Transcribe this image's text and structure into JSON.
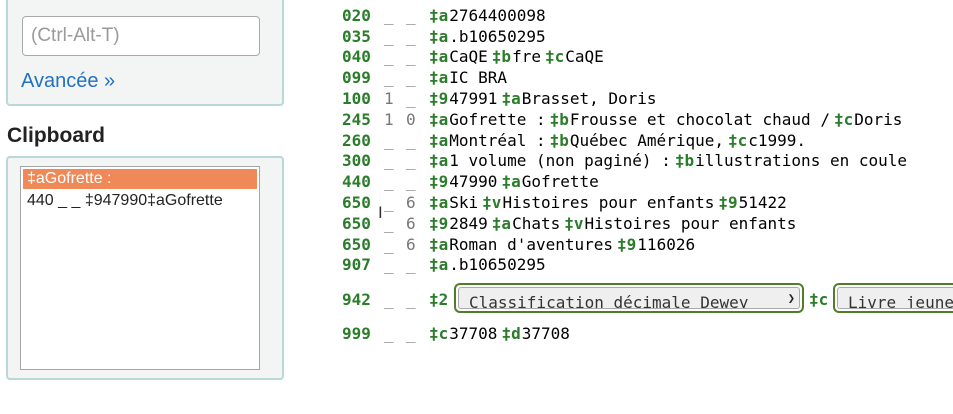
{
  "sidebar": {
    "search": {
      "placeholder": "(Ctrl-Alt-T)",
      "advanced_label": "Avancée »"
    },
    "clipboard": {
      "title": "Clipboard",
      "items": [
        {
          "text": "‡aGofrette :",
          "selected": true
        },
        {
          "text": "440 _ _ ‡947990‡aGofrette",
          "selected": false
        }
      ]
    }
  },
  "marc": {
    "rows": [
      {
        "tag": "020",
        "ind1": "_",
        "ind2": "_",
        "subfields": [
          {
            "code": "‡a",
            "value": "2764400098"
          }
        ]
      },
      {
        "tag": "035",
        "ind1": "_",
        "ind2": "_",
        "subfields": [
          {
            "code": "‡a",
            "value": ".b10650295"
          }
        ]
      },
      {
        "tag": "040",
        "ind1": "_",
        "ind2": "_",
        "subfields": [
          {
            "code": "‡a",
            "value": "CaQE"
          },
          {
            "code": "‡b",
            "value": "fre"
          },
          {
            "code": "‡c",
            "value": "CaQE"
          }
        ]
      },
      {
        "tag": "099",
        "ind1": "_",
        "ind2": "_",
        "subfields": [
          {
            "code": "‡a",
            "value": "IC BRA"
          }
        ]
      },
      {
        "tag": "100",
        "ind1": "1",
        "ind2": "_",
        "subfields": [
          {
            "code": "‡9",
            "value": "47991"
          },
          {
            "code": "‡a",
            "value": "Brasset, Doris"
          }
        ]
      },
      {
        "tag": "245",
        "ind1": "1",
        "ind2": "0",
        "subfields": [
          {
            "code": "‡a",
            "value": "Gofrette :"
          },
          {
            "code": "‡b",
            "value": "Frousse et chocolat chaud /"
          },
          {
            "code": "‡c",
            "value": "Doris"
          }
        ]
      },
      {
        "tag": "260",
        "ind1": "_",
        "ind2": "_",
        "subfields": [
          {
            "code": "‡a",
            "value": "Montréal :"
          },
          {
            "code": "‡b",
            "value": "Québec Amérique,"
          },
          {
            "code": "‡c",
            "value": "c1999."
          }
        ]
      },
      {
        "tag": "300",
        "ind1": "_",
        "ind2": "_",
        "subfields": [
          {
            "code": "‡a",
            "value": "1 volume (non paginé) :"
          },
          {
            "code": "‡b",
            "value": "illustrations en coule"
          }
        ]
      },
      {
        "tag": "440",
        "ind1": "_",
        "ind2": "_",
        "subfields": [
          {
            "code": "‡9",
            "value": "47990"
          },
          {
            "code": "‡a",
            "value": "Gofrette"
          }
        ]
      },
      {
        "tag": "650",
        "ind1": "_",
        "ind2": "6",
        "subfields": [
          {
            "code": "‡a",
            "value": "Ski"
          },
          {
            "code": "‡v",
            "value": "Histoires pour enfants"
          },
          {
            "code": "‡9",
            "value": "51422"
          }
        ]
      },
      {
        "tag": "650",
        "ind1": "_",
        "ind2": "6",
        "subfields": [
          {
            "code": "‡9",
            "value": "2849"
          },
          {
            "code": "‡a",
            "value": "Chats"
          },
          {
            "code": "‡v",
            "value": "Histoires pour enfants"
          }
        ]
      },
      {
        "tag": "650",
        "ind1": "_",
        "ind2": "6",
        "subfields": [
          {
            "code": "‡a",
            "value": "Roman d'aventures"
          },
          {
            "code": "‡9",
            "value": "116026"
          }
        ]
      },
      {
        "tag": "907",
        "ind1": "_",
        "ind2": "_",
        "subfields": [
          {
            "code": "‡a",
            "value": ".b10650295"
          }
        ]
      }
    ],
    "row942": {
      "tag": "942",
      "ind1": "_",
      "ind2": "_",
      "code2": "‡2",
      "select2": "Classification décimale Dewey",
      "codec": "‡c",
      "selectc": "Livre jeunesse"
    },
    "row999": {
      "tag": "999",
      "ind1": "_",
      "ind2": "_",
      "subfields": [
        {
          "code": "‡c",
          "value": "37708"
        },
        {
          "code": "‡d",
          "value": "37708"
        }
      ]
    }
  }
}
